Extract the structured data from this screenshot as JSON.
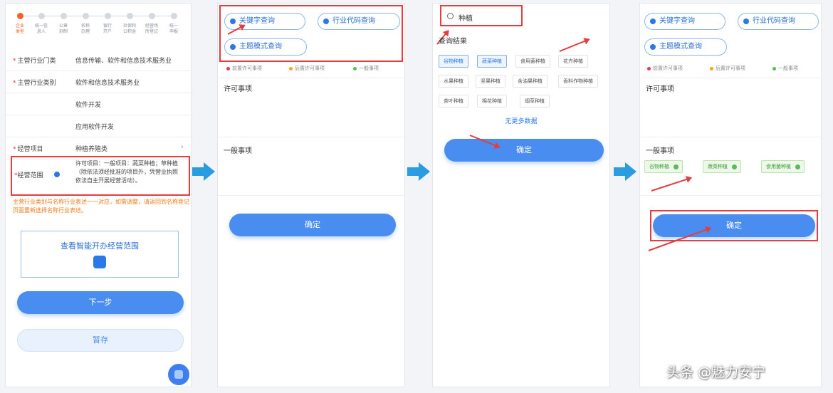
{
  "panel1": {
    "steps": [
      "企业\n类型",
      "统一信\n息人",
      "公章\n刻制",
      "名称\n办理",
      "银行\n开户",
      "社保和\n公积金",
      "经营场\n所登记",
      "统一\n申报"
    ],
    "rows": [
      {
        "key": "主营行业门类",
        "value": "信息传输、软件和信息技术服务业",
        "required": true
      },
      {
        "key": "主营行业类别",
        "value": "软件和信息技术服务业",
        "required": true
      },
      {
        "key": "",
        "value": "软件开发",
        "required": false
      },
      {
        "key": "",
        "value": "应用软件开发",
        "required": false
      },
      {
        "key": "经营项目",
        "value": "种植养殖类",
        "required": true
      }
    ],
    "scope_key": "经营范围",
    "scope_text": "许可项目：一般项目：蔬菜种植；草种植（除依法须经批准的项目外，凭营业执照依法自主开展经营活动）。",
    "note": "主营行业类别与名称行业表述一一对应，如需调整，请返回到名称登记页面重新选择名称行业表述。",
    "smart_scope": "查看智能开办经营范围",
    "next_label": "下一步",
    "save_label": "暂存"
  },
  "panel2": {
    "pill_keyword": "关键字查询",
    "pill_industry": "行业代码查询",
    "pill_theme": "主题模式查询",
    "legend": [
      "前置许可事项",
      "后置许可事项",
      "一般事项"
    ],
    "section_permit": "许可事项",
    "section_general": "一般事项",
    "confirm_label": "确定"
  },
  "panel3": {
    "search_value": "种植",
    "results_title": "查询结果",
    "tags": [
      "谷物种植",
      "蔬菜种植",
      "食用菌种植",
      "花卉种植",
      "水果种植",
      "坚果种植",
      "含油果种植",
      "香料作物种植",
      "茶叶种植",
      "棉花种植",
      "烟草种植"
    ],
    "no_more": "无更多数据",
    "confirm_label": "确定"
  },
  "panel4": {
    "pill_keyword": "关键字查询",
    "pill_industry": "行业代码查询",
    "pill_theme": "主题模式查询",
    "legend": [
      "前置许可事项",
      "后置许可事项",
      "一般事项"
    ],
    "section_permit": "许可事项",
    "section_general": "一般事项",
    "chips": [
      "谷物种植",
      "蔬菜种植",
      "食用菌种植"
    ],
    "confirm_label": "确定"
  },
  "watermark": "头条 @魅力安宁",
  "colors": {
    "primary": "#4a8df0",
    "highlight": "#e53d3d",
    "arrow": "#2a9de0"
  }
}
